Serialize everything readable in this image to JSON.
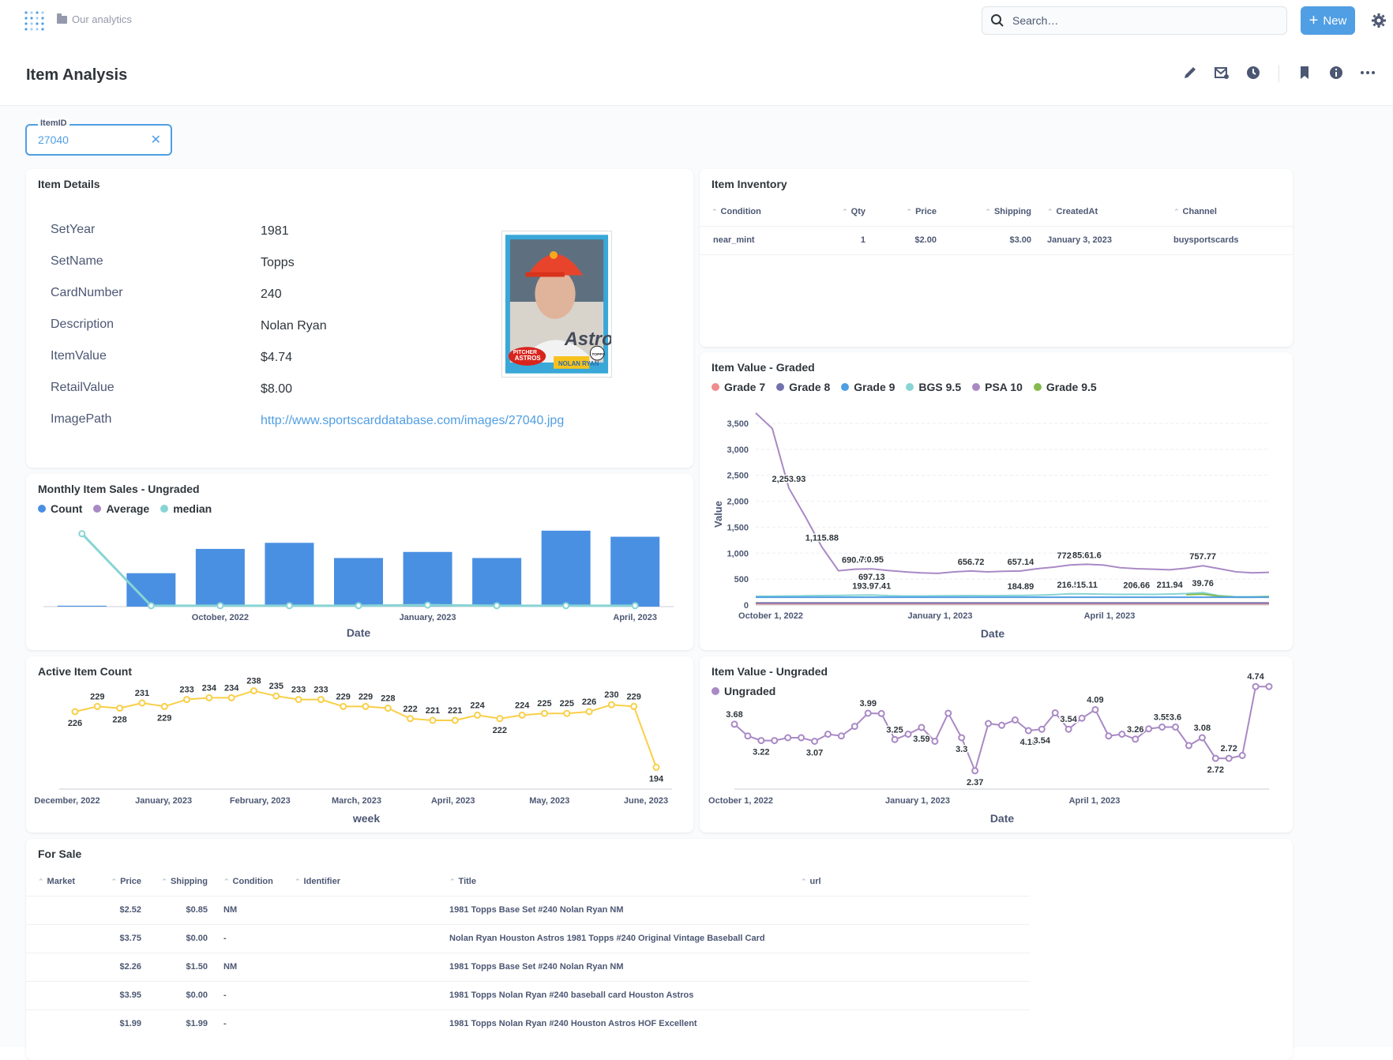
{
  "app": {
    "breadcrumb": "Our analytics",
    "search_placeholder": "Search…",
    "new_label": "New"
  },
  "page": {
    "title": "Item Analysis"
  },
  "filter": {
    "label": "ItemID",
    "value": "27040"
  },
  "item_details": {
    "title": "Item Details",
    "rows": [
      {
        "label": "SetYear",
        "value": "1981"
      },
      {
        "label": "SetName",
        "value": "Topps"
      },
      {
        "label": "CardNumber",
        "value": "240"
      },
      {
        "label": "Description",
        "value": "Nolan Ryan"
      },
      {
        "label": "ItemValue",
        "value": "$4.74"
      },
      {
        "label": "RetailValue",
        "value": "$8.00"
      },
      {
        "label": "ImagePath",
        "value": "http://www.sportscarddatabase.com/images/27040.jpg"
      }
    ],
    "card_text": {
      "team": "Astros",
      "name": "NOLAN RYAN",
      "position": "PITCHER",
      "team_banner": "ASTROS",
      "brand": "TOPPS"
    }
  },
  "inventory": {
    "title": "Item Inventory",
    "columns": [
      "Condition",
      "Qty",
      "Price",
      "Shipping",
      "CreatedAt",
      "Channel"
    ],
    "rows": [
      [
        "near_mint",
        "1",
        "$2.00",
        "$3.00",
        "January 3, 2023",
        "buysportscards"
      ]
    ]
  },
  "monthly_sales": {
    "title": "Monthly Item Sales - Ungraded",
    "legend": [
      "Count",
      "Average",
      "median"
    ],
    "colors": {
      "count": "#4a90e2",
      "average": "#a989c5",
      "median": "#88d4d4"
    }
  },
  "graded": {
    "title": "Item Value - Graded",
    "legend": [
      "Grade 7",
      "Grade 8",
      "Grade 9",
      "BGS 9.5",
      "PSA 10",
      "Grade 9.5"
    ],
    "colors": [
      "#ef8c8c",
      "#7172ad",
      "#509ee3",
      "#88d4d4",
      "#a989c5",
      "#84bb4c"
    ]
  },
  "active_count": {
    "title": "Active Item Count",
    "color": "#f9cf48"
  },
  "ungraded": {
    "title": "Item Value - Ungraded",
    "legend": [
      "Ungraded"
    ],
    "color": "#a989c5"
  },
  "for_sale": {
    "title": "For Sale",
    "columns": [
      "Market",
      "Price",
      "Shipping",
      "Condition",
      "Identifier",
      "Title",
      "url"
    ],
    "rows": [
      [
        "",
        "$2.52",
        "$0.85",
        "NM",
        "",
        "1981 Topps Base Set #240 Nolan Ryan NM",
        ""
      ],
      [
        "",
        "$3.75",
        "$0.00",
        "-",
        "",
        "Nolan Ryan Houston Astros 1981 Topps #240 Original Vintage Baseball Card",
        ""
      ],
      [
        "",
        "$2.26",
        "$1.50",
        "NM",
        "",
        "1981 Topps Base Set #240 Nolan Ryan NM",
        ""
      ],
      [
        "",
        "$3.95",
        "$0.00",
        "-",
        "",
        "1981 Topps Nolan Ryan #240 baseball card Houston Astros",
        ""
      ],
      [
        "",
        "$1.99",
        "$1.99",
        "-",
        "",
        "1981 Topps Nolan Ryan #240 Houston Astros HOF Excellent",
        ""
      ]
    ]
  },
  "chart_data": [
    {
      "type": "bar",
      "title": "Monthly Item Sales - Ungraded",
      "xlabel": "Date",
      "ylabel": "",
      "x_ticks": [
        "October, 2022",
        "January, 2023",
        "April, 2023"
      ],
      "series": [
        {
          "name": "Count",
          "type": "bar",
          "values": [
            0.3,
            11,
            19,
            21,
            16,
            18,
            16,
            25,
            23
          ]
        },
        {
          "name": "median",
          "type": "line",
          "values": [
            24,
            0.3,
            0.3,
            0.3,
            0.3,
            0.5,
            0.3,
            0.3,
            0.3
          ]
        }
      ],
      "legend": "top-left"
    },
    {
      "type": "line",
      "title": "Item Value - Graded",
      "xlabel": "Date",
      "ylabel": "Value",
      "ylim": [
        0,
        3500
      ],
      "y_ticks": [
        "0",
        "500",
        "1,000",
        "1,500",
        "2,000",
        "2,500",
        "3,000",
        "3,500"
      ],
      "x_ticks": [
        "October 1, 2022",
        "January 1, 2023",
        "April 1, 2023"
      ],
      "series": [
        {
          "name": "PSA 10",
          "values": [
            3700,
            3400,
            2253.93,
            1700,
            1115.88,
            660,
            690.69,
            697.13,
            665,
            640,
            620,
            610,
            640,
            656.72,
            640,
            650,
            657.14,
            700,
            730,
            772.57,
            785.61,
            770,
            720,
            700,
            690,
            680,
            710,
            757.77,
            700,
            640,
            620,
            630
          ]
        },
        {
          "name": "BGS 9.5",
          "values": [
            170,
            172,
            175,
            178,
            183,
            185,
            190,
            193.97,
            180,
            175,
            175,
            178,
            180,
            182,
            180,
            183,
            184.89,
            190,
            200,
            216.53,
            215.11,
            210,
            205,
            206.66,
            205,
            211.94,
            220,
            239.76,
            180,
            160,
            160,
            165
          ]
        },
        {
          "name": "Grade 9.5",
          "values": [
            0,
            0,
            0,
            0,
            0,
            0,
            0,
            0,
            0,
            0,
            0,
            0,
            0,
            0,
            0,
            0,
            0,
            0,
            0,
            0,
            0,
            0,
            0,
            0,
            0,
            0,
            200,
            210,
            170,
            150,
            150,
            160
          ]
        },
        {
          "name": "Grade 9",
          "values": [
            150,
            150,
            150,
            150,
            150,
            150,
            150,
            150,
            150,
            150,
            150,
            150,
            150,
            150,
            150,
            150,
            150,
            150,
            150,
            150,
            150,
            150,
            150,
            150,
            150,
            150,
            150,
            150,
            150,
            150,
            150,
            150
          ]
        },
        {
          "name": "Grade 7",
          "values": [
            25,
            25,
            25,
            25,
            25,
            25,
            25,
            25,
            25,
            25,
            25,
            25,
            25,
            25,
            25,
            25,
            25,
            25,
            25,
            25,
            25,
            25,
            25,
            25,
            25,
            25,
            25,
            25,
            25,
            25,
            25,
            25
          ]
        },
        {
          "name": "Grade 8",
          "values": [
            40,
            40,
            40,
            40,
            40,
            40,
            40,
            40,
            40,
            40,
            40,
            40,
            40,
            40,
            40,
            40,
            40,
            40,
            40,
            40,
            40,
            40,
            40,
            40,
            40,
            40,
            40,
            40,
            40,
            40,
            40,
            40
          ]
        }
      ],
      "point_labels": [
        {
          "i": 2,
          "series": "PSA 10",
          "text": "2,253.93"
        },
        {
          "i": 4,
          "series": "PSA 10",
          "text": "1,115.88"
        },
        {
          "i": 6,
          "series": "PSA 10",
          "text": "690.69"
        },
        {
          "i": 7,
          "series": "PSA 10",
          "text": "7.0.95"
        },
        {
          "i": 7,
          "series": "PSA 10",
          "text": "697.13",
          "below": true
        },
        {
          "i": 13,
          "series": "PSA 10",
          "text": "656.72"
        },
        {
          "i": 16,
          "series": "PSA 10",
          "text": "657.14"
        },
        {
          "i": 19,
          "series": "PSA 10",
          "text": "772.57"
        },
        {
          "i": 20,
          "series": "PSA 10",
          "text": "85.61.6"
        },
        {
          "i": 27,
          "series": "PSA 10",
          "text": "757.77"
        },
        {
          "i": 7,
          "series": "BGS 9.5",
          "text": "193.97.41"
        },
        {
          "i": 16,
          "series": "BGS 9.5",
          "text": "184.89"
        },
        {
          "i": 19,
          "series": "BGS 9.5",
          "text": "216.53"
        },
        {
          "i": 20,
          "series": "BGS 9.5",
          "text": "15.11"
        },
        {
          "i": 23,
          "series": "BGS 9.5",
          "text": "206.66"
        },
        {
          "i": 25,
          "series": "BGS 9.5",
          "text": "211.94"
        },
        {
          "i": 27,
          "series": "BGS 9.5",
          "text": "39.76"
        }
      ],
      "legend": "top-left"
    },
    {
      "type": "line",
      "title": "Active Item Count",
      "xlabel": "week",
      "ylabel": "",
      "x_ticks": [
        "December, 2022",
        "January, 2023",
        "February, 2023",
        "March, 2023",
        "April, 2023",
        "May, 2023",
        "June, 2023"
      ],
      "series": [
        {
          "name": "Active Item Count",
          "values": [
            226,
            229,
            228,
            231,
            229,
            233,
            234,
            234,
            238,
            235,
            233,
            233,
            229,
            229,
            228,
            222,
            221,
            221,
            224,
            222,
            224,
            225,
            225,
            226,
            230,
            229,
            194
          ]
        }
      ],
      "labels_below": [
        0,
        2,
        4,
        19,
        26
      ]
    },
    {
      "type": "line",
      "title": "Item Value - Ungraded",
      "xlabel": "Date",
      "ylabel": "",
      "x_ticks": [
        "October 1, 2022",
        "January 1, 2023",
        "April 1, 2023"
      ],
      "series": [
        {
          "name": "Ungraded",
          "values": [
            3.68,
            3.35,
            3.22,
            3.22,
            3.3,
            3.3,
            3.2,
            3.4,
            3.35,
            3.62,
            3.99,
            3.98,
            3.25,
            3.4,
            3.59,
            3.2,
            3.99,
            3.3,
            2.37,
            3.7,
            3.65,
            3.8,
            3.5,
            3.54,
            4.0,
            3.54,
            3.85,
            4.09,
            3.35,
            3.4,
            3.26,
            3.55,
            3.6,
            3.6,
            3.08,
            3.3,
            2.72,
            2.72,
            2.8,
            4.74,
            4.74
          ]
        }
      ],
      "point_labels": [
        {
          "i": 0,
          "text": "3.68"
        },
        {
          "i": 2,
          "text": "3.22",
          "below": true
        },
        {
          "i": 6,
          "text": "3.07",
          "below": true
        },
        {
          "i": 10,
          "text": "3.99"
        },
        {
          "i": 12,
          "text": "3.25"
        },
        {
          "i": 14,
          "text": "3.59",
          "below": true
        },
        {
          "i": 17,
          "text": "3.3",
          "below": true
        },
        {
          "i": 18,
          "text": "2.37",
          "below": true
        },
        {
          "i": 22,
          "text": "4.16",
          "below": true
        },
        {
          "i": 23,
          "text": "3.54",
          "below": true
        },
        {
          "i": 25,
          "text": "3.54"
        },
        {
          "i": 27,
          "text": "4.09"
        },
        {
          "i": 30,
          "text": "3.26"
        },
        {
          "i": 32,
          "text": "3.55"
        },
        {
          "i": 33,
          "text": "3.6"
        },
        {
          "i": 35,
          "text": "3.08"
        },
        {
          "i": 37,
          "text": "2.72"
        },
        {
          "i": 36,
          "text": "2.72",
          "below": true
        },
        {
          "i": 39,
          "text": "4.74"
        }
      ],
      "legend": "top-left"
    }
  ]
}
